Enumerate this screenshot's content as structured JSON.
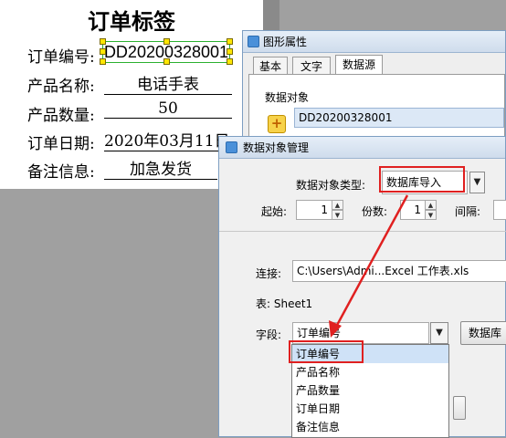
{
  "label": {
    "title": "订单标签",
    "rows": [
      {
        "label": "订单编号:",
        "value": "DD20200328001"
      },
      {
        "label": "产品名称:",
        "value": "电话手表"
      },
      {
        "label": "产品数量:",
        "value": "50"
      },
      {
        "label": "订单日期:",
        "value": "2020年03月11日"
      },
      {
        "label": "备注信息:",
        "value": "加急发货"
      }
    ]
  },
  "props_window": {
    "title": "图形属性",
    "tabs": [
      "基本",
      "文字",
      "数据源"
    ],
    "active_tab": "数据源",
    "group_label": "数据对象",
    "add_icon_glyph": "+",
    "data_object": "DD20200328001"
  },
  "data_manager": {
    "title": "数据对象管理",
    "type_label": "数据对象类型:",
    "type_value": "数据库导入",
    "start_label": "起始:",
    "start_value": "1",
    "copies_label": "份数:",
    "copies_value": "1",
    "interval_label": "间隔:",
    "connect_label": "连接:",
    "connect_value": "C:\\Users\\Admi...Excel 工作表.xls",
    "table_label": "表: Sheet1",
    "field_label": "字段:",
    "field_value": "订单编号",
    "db_button": "数据库",
    "field_options": [
      "订单编号",
      "产品名称",
      "产品数量",
      "订单日期",
      "备注信息"
    ],
    "dropdown_glyph": "▼",
    "spin_up": "▲",
    "spin_down": "▼"
  },
  "colors": {
    "highlight": "#e02020",
    "selection_border": "#2bb030",
    "handle": "#ffe600",
    "window_border": "#7d9ec2"
  }
}
